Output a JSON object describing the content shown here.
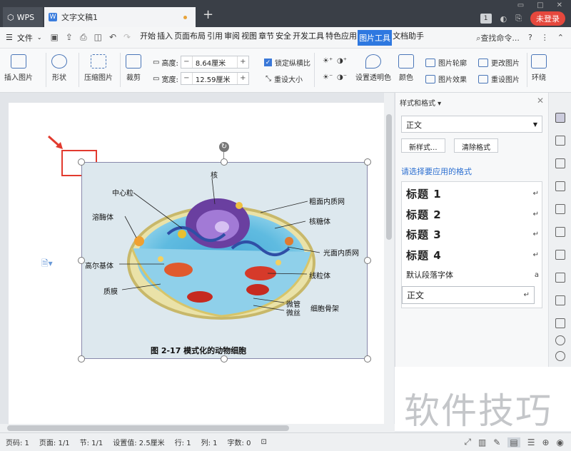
{
  "titlebar": {
    "wps_label": "WPS",
    "doc_tab_title": "文字文稿1",
    "add_tab": "+",
    "count_badge": "1",
    "login_label": "未登录"
  },
  "menubar": {
    "file_label": "文件",
    "tabs": [
      "开始",
      "插入",
      "页面布局",
      "引用",
      "审阅",
      "视图",
      "章节",
      "安全",
      "开发工具",
      "特色应用",
      "图片工具",
      "文档助手"
    ],
    "active_tab": "图片工具",
    "search_label": "查找命令..."
  },
  "ribbon": {
    "insert_picture": "插入图片",
    "shape": "形状",
    "compress": "压缩图片",
    "crop": "裁剪",
    "height_label": "高度:",
    "height_value": "8.64厘米",
    "width_label": "宽度:",
    "width_value": "12.59厘米",
    "lock_ratio": "锁定纵横比",
    "reset_size": "重设大小",
    "set_transparent": "设置透明色",
    "color": "颜色",
    "picture_outline": "图片轮廓",
    "picture_effect": "图片效果",
    "change_picture": "更改图片",
    "reset_picture": "重设图片",
    "wrap": "环绕"
  },
  "image": {
    "labels": {
      "nucleus": "核",
      "centriole": "中心粒",
      "rough_er": "粗面内质网",
      "lysosome": "溶酶体",
      "ribosome": "核糖体",
      "smooth_er": "光面内质网",
      "golgi": "高尔基体",
      "mitochondria": "线粒体",
      "membrane": "质膜",
      "microtubule": "微管",
      "microfilament": "微丝",
      "cytoskeleton": "细胞骨架"
    },
    "caption": "图 2-17    模式化的动物细胞"
  },
  "sidepanel": {
    "title": "样式和格式",
    "current_style": "正文",
    "new_style": "新样式...",
    "clear_format": "清除格式",
    "prompt": "请选择要应用的格式",
    "styles": [
      {
        "name": "标题 1",
        "mark": "↵"
      },
      {
        "name": "标题 2",
        "mark": "↵"
      },
      {
        "name": "标题 3",
        "mark": "↵"
      },
      {
        "name": "标题 4",
        "mark": "↵"
      },
      {
        "name": "默认段落字体",
        "mark": "a"
      },
      {
        "name": "正文",
        "mark": "↵"
      }
    ]
  },
  "watermark": "软件技巧",
  "statusbar": {
    "page_no": "页码: 1",
    "pages": "页面: 1/1",
    "section": "节: 1/1",
    "setting": "设置值: 2.5厘米",
    "row": "行: 1",
    "col": "列: 1",
    "words": "字数: 0"
  }
}
